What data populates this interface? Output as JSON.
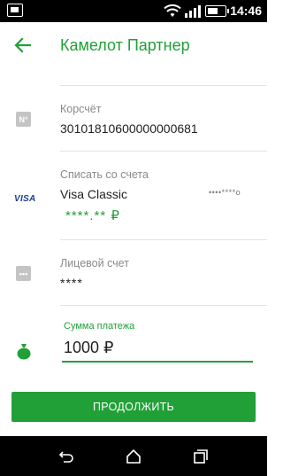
{
  "status_bar": {
    "time": "14:46",
    "battery_level": 0.65
  },
  "header": {
    "title": "Камелот Партнер"
  },
  "fields": {
    "corr_account": {
      "label": "Корсчёт",
      "value": "30101810600000000681",
      "icon_text": "N°"
    },
    "debit_account": {
      "label": "Списать со счета",
      "card_name": "Visa Classic",
      "card_mask": "••••****o",
      "balance": "****.** ₽",
      "icon_text": "VISA"
    },
    "personal_account": {
      "label": "Лицевой счет",
      "value": "****",
      "icon_text": "•••"
    },
    "amount": {
      "label": "Сумма платежа",
      "value": "1000 ₽"
    }
  },
  "actions": {
    "continue_label": "ПРОДОЛЖИТЬ"
  },
  "colors": {
    "accent": "#21a038",
    "visa_blue": "#1a3f8f"
  },
  "icons": {
    "back": "arrow-left-icon",
    "amount": "money-bag-icon",
    "nav": [
      "back-nav-icon",
      "home-nav-icon",
      "recents-nav-icon"
    ]
  }
}
